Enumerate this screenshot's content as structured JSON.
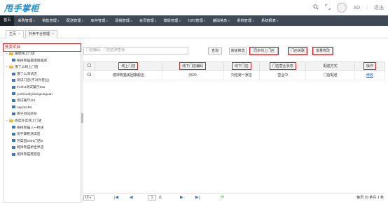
{
  "app": {
    "logo_text": "甩手掌柜"
  },
  "topbar": {
    "user": "SD",
    "logout": "退出"
  },
  "nav": {
    "items": [
      {
        "label": "首页",
        "active": true
      },
      {
        "label": "采购管理",
        "caret": true
      },
      {
        "label": "销售管理",
        "caret": true
      },
      {
        "label": "配送管理",
        "caret": true
      },
      {
        "label": "库存管理",
        "caret": true
      },
      {
        "label": "促销管理",
        "caret": true
      },
      {
        "label": "会员管理",
        "caret": true
      },
      {
        "label": "模板管理",
        "caret": true
      },
      {
        "label": "O2O管理",
        "caret": true
      },
      {
        "label": "基础信息",
        "caret": true
      },
      {
        "label": "系统管理",
        "caret": true
      },
      {
        "label": "系统报表",
        "caret": true
      }
    ]
  },
  "tabs": [
    {
      "label": "主页"
    },
    {
      "label": "外卖平台管理"
    }
  ],
  "sidebar": {
    "header": "外卖平台",
    "tree": [
      {
        "label": "美团线上门店",
        "type": "folder",
        "level": 0,
        "toggle": "−"
      },
      {
        "label": "德祥熊猫美团旗舰店",
        "type": "leaf",
        "level": 1
      },
      {
        "label": "饿了么线上门店",
        "type": "folder",
        "level": 0,
        "toggle": "−"
      },
      {
        "label": "饿了么测试店",
        "type": "leaf",
        "level": 1
      },
      {
        "label": "测试门店(不对外营业)",
        "type": "leaf",
        "level": 1
      },
      {
        "label": "fresh4测试餐厅dsa",
        "type": "leaf",
        "level": 1
      },
      {
        "label": "yuzhoudiyixiangcaiguan",
        "type": "leaf",
        "level": 1
      },
      {
        "label": "测试餐厅111",
        "type": "leaf",
        "level": 1
      },
      {
        "label": "napos158",
        "type": "leaf",
        "level": 1
      },
      {
        "label": "南宁测试店号",
        "type": "leaf",
        "level": 1
      },
      {
        "label": "百度外卖线上门店",
        "type": "folder",
        "level": 0,
        "toggle": "−"
      },
      {
        "label": "德祥熊猫八一桥店",
        "type": "leaf",
        "level": 1
      },
      {
        "label": "甩手掌柜测试店",
        "type": "leaf",
        "level": 1
      },
      {
        "label": "芹菜园2001门店2",
        "type": "leaf",
        "level": 1
      },
      {
        "label": "德祥熊猫新世界店",
        "type": "leaf",
        "level": 1
      },
      {
        "label": "德祥熊猫芙蓉店",
        "type": "leaf",
        "level": 1
      }
    ]
  },
  "toolbar": {
    "search_placeholder": "门店编码、门店名称查询",
    "query": "查询",
    "advanced": "高级筛选",
    "sync": "同步线上门店",
    "link": "门店关联",
    "batch_edit": "批量修改"
  },
  "grid": {
    "headers": [
      "",
      "线上门店",
      "线下门店编码",
      "线下门店",
      "门店营业状态",
      "配送方式",
      "操作"
    ],
    "rows": [
      {
        "online_store": "德祥熊猫美团旗舰店",
        "offline_code": "0520",
        "offline_store": "刘佳第一家店",
        "status": "营业中",
        "delivery": "门店配送",
        "action": "修改"
      }
    ]
  },
  "pager": {
    "page_size": "10",
    "page": "1",
    "total_pages": "/1",
    "summary": "每页 10 条共 1 条"
  }
}
